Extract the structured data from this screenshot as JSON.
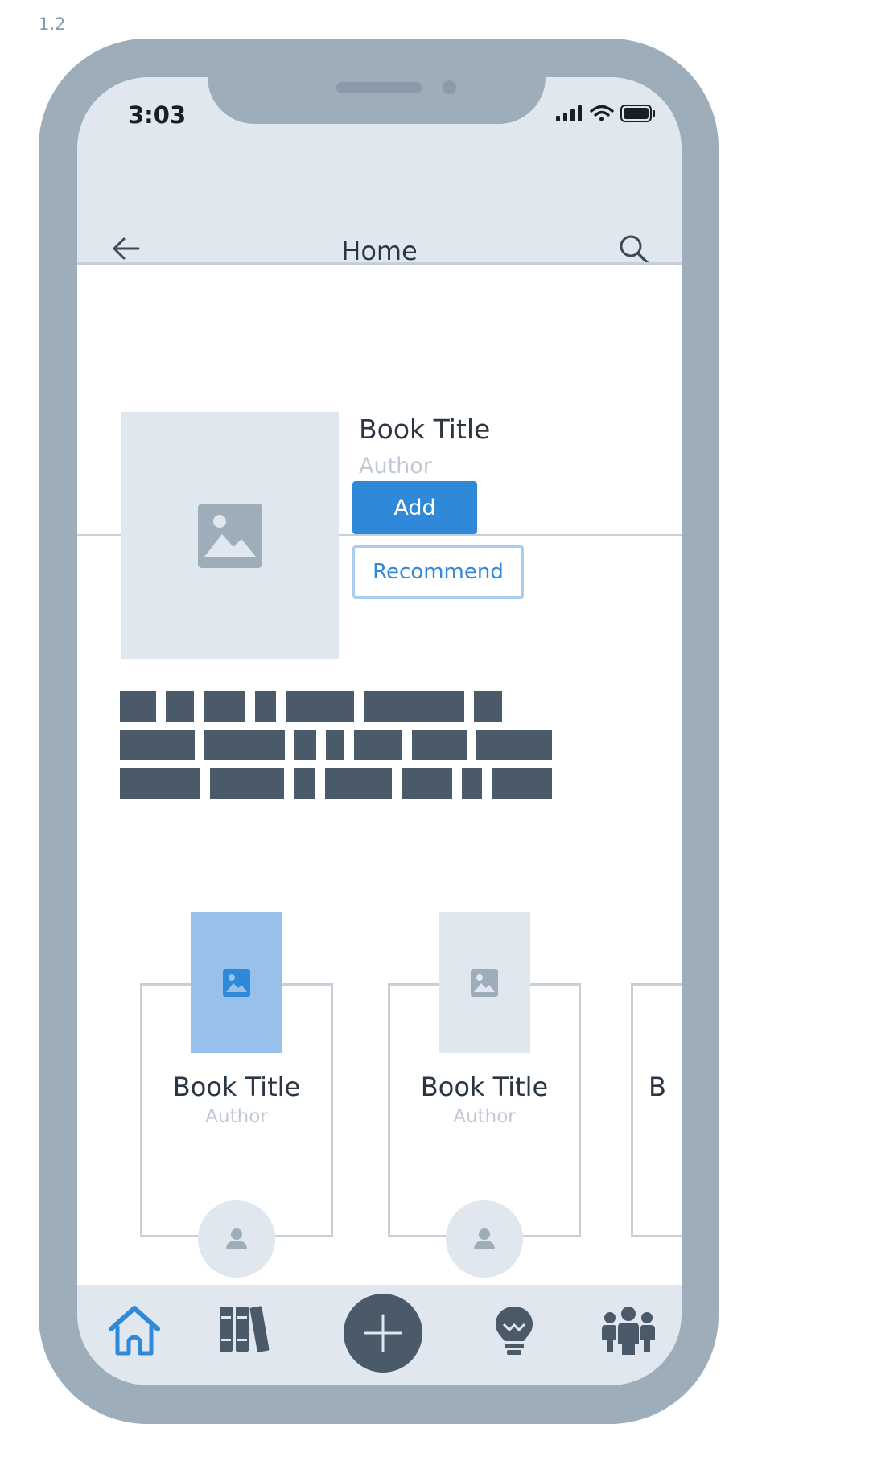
{
  "version_label": "1.2",
  "status_bar": {
    "time": "3:03"
  },
  "header": {
    "title": "Home"
  },
  "featured": {
    "title": "Book Title",
    "author": "Author",
    "add_label": "Add",
    "recommend_label": "Recommend"
  },
  "cards": [
    {
      "title": "Book Title",
      "author": "Author"
    },
    {
      "title": "Book Title",
      "author": "Author"
    },
    {
      "title": "B"
    }
  ],
  "tab_bar": {
    "items": [
      "home-icon",
      "library-icon",
      "add-icon",
      "ideas-icon",
      "community-icon"
    ],
    "active": "home-icon"
  },
  "colors": {
    "accent": "#2f88d8",
    "accent_light": "#97c1ea",
    "frame": "#9eadba",
    "surface": "#e1e7ee",
    "dark": "#4b5a69"
  }
}
